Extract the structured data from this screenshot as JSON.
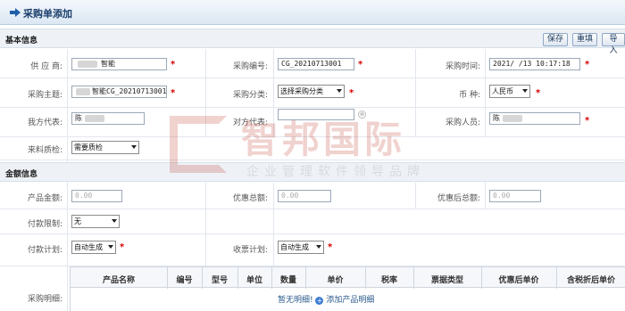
{
  "page": {
    "title": "采购单添加"
  },
  "toolbar": {
    "save_label": "保存",
    "reset_label": "重填",
    "import_label": "导入"
  },
  "basic": {
    "section_label": "基本信息",
    "supplier_label": "供 应 商:",
    "supplier_value": "智能",
    "order_no_label": "采购编号:",
    "order_no_value": "CG_20210713001",
    "purchase_time_label": "采购时间:",
    "purchase_time_value": "2021/ /13 10:17:18",
    "subject_label": "采购主题:",
    "subject_value": "智能CG_20210713001",
    "category_label": "采购分类:",
    "category_value": "选择采购分类",
    "currency_label": "币    种:",
    "currency_value": "人民币",
    "our_rep_label": "我方代表:",
    "our_rep_value": "陈",
    "their_rep_label": "对方代表:",
    "their_rep_value": "",
    "purchaser_label": "采购人员:",
    "purchaser_value": "陈",
    "inspection_label": "来料质检:",
    "inspection_value": "需要质检"
  },
  "amount": {
    "section_label": "金额信息",
    "product_amount_label": "产品金额:",
    "product_amount_value": "0.00",
    "discount_total_label": "优惠总额:",
    "discount_total_value": "0.00",
    "after_discount_label": "优惠后总额:",
    "after_discount_value": "0.00",
    "payment_limit_label": "付款限制:",
    "payment_limit_value": "无",
    "payment_plan_label": "付款计划:",
    "payment_plan_value": "自动生成",
    "receipt_plan_label": "收票计划:",
    "receipt_plan_value": "自动生成"
  },
  "details": {
    "label": "采购明细:",
    "columns": [
      "产品名称",
      "编号",
      "型号",
      "单位",
      "数量",
      "单价",
      "税率",
      "票据类型",
      "优惠后单价",
      "含税折后单价"
    ],
    "empty_text": "暂无明细!",
    "add_label": "添加产品明细"
  },
  "watermark": {
    "brand": "智邦国际",
    "slogan": "企业管理软件领导品牌"
  },
  "colors": {
    "required": "#d40000",
    "header_text": "#1a3d6b",
    "section_bg": "#eef2f7"
  },
  "icons": {
    "title_arrow": "arrow-right-icon",
    "add": "plus-circle-icon",
    "clear": "clear-icon"
  }
}
